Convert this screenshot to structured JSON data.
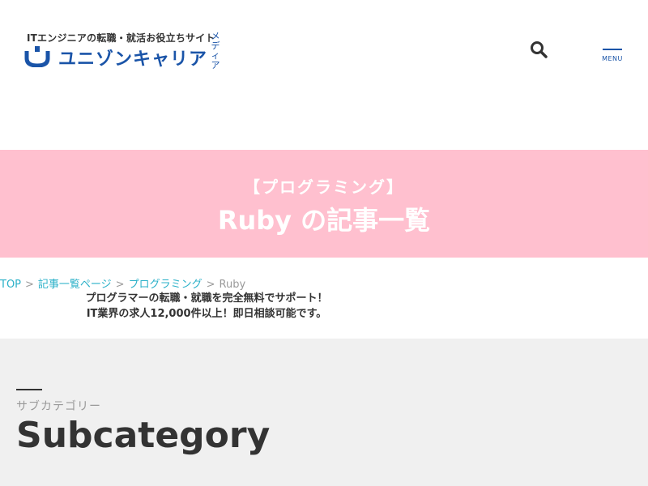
{
  "header": {
    "logo_tagline": "ITエンジニアの転職・就活お役立ちサイト",
    "logo_name": "ユニゾンキャリア",
    "logo_sub": "メディア",
    "search_icon": "search-icon",
    "menu_label": "MENU"
  },
  "hero": {
    "category": "【プログラミング】",
    "title": "Ruby の記事一覧"
  },
  "breadcrumb": {
    "items": [
      "TOP",
      "記事一覧ページ",
      "プログラミング"
    ],
    "current": "Ruby",
    "separator": ">"
  },
  "promo": {
    "line1": "プログラマーの転職・就職を完全無料でサポート！",
    "line2": "IT業界の求人12,000件以上！即日相談可能です。"
  },
  "section": {
    "heading_jp": "サブカテゴリー",
    "heading_en": "Subcategory"
  },
  "colors": {
    "brand_blue": "#1a54a8",
    "hero_pink": "#ffc0cf",
    "link_cyan": "#2ab0c8",
    "section_gray": "#f0f0f0"
  }
}
